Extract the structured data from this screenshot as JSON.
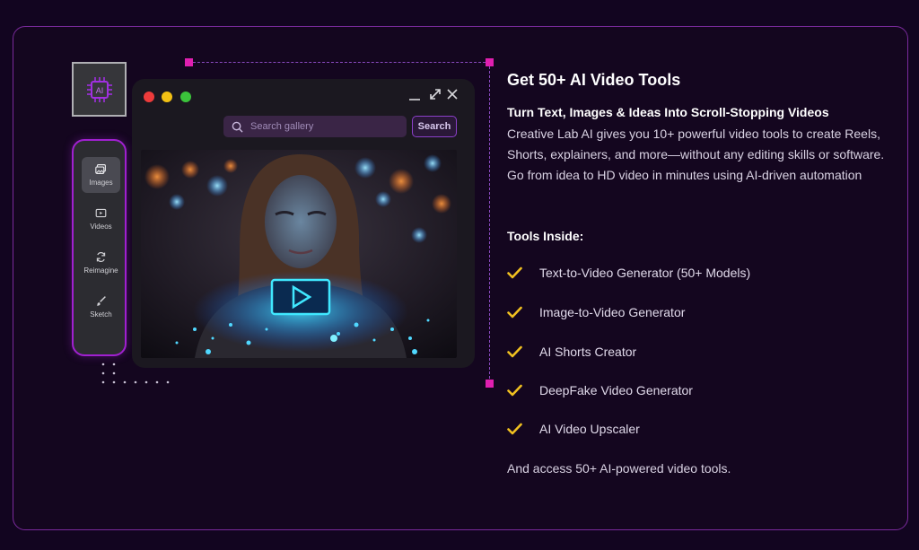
{
  "colors": {
    "accent": "#a020d0",
    "handle": "#e01fb0",
    "check": "#f0c020",
    "background": "#120520"
  },
  "sidebar": {
    "items": [
      {
        "label": "Images",
        "icon": "images-icon",
        "active": true
      },
      {
        "label": "Videos",
        "icon": "video-icon",
        "active": false
      },
      {
        "label": "Reimagine",
        "icon": "refresh-icon",
        "active": false
      },
      {
        "label": "Sketch",
        "icon": "brush-icon",
        "active": false
      }
    ]
  },
  "chip": {
    "label": "AI",
    "icon": "ai-chip-icon"
  },
  "window": {
    "search_placeholder": "Search gallery",
    "search_button": "Search"
  },
  "content": {
    "title": "Get 50+ AI Video Tools",
    "subtitle": "Turn Text, Images & Ideas Into Scroll-Stopping Videos",
    "description": "Creative Lab AI gives you 10+ powerful video tools to create Reels, Shorts, explainers, and more—without any editing skills or software. Go from idea to HD video in minutes using AI-driven automation",
    "tools_heading": "Tools Inside:",
    "tools": [
      "Text-to-Video Generator (50+ Models)",
      "Image-to-Video Generator",
      "AI Shorts Creator",
      "DeepFake Video Generator",
      "AI Video Upscaler"
    ],
    "footer": "And access 50+ AI-powered video tools."
  }
}
